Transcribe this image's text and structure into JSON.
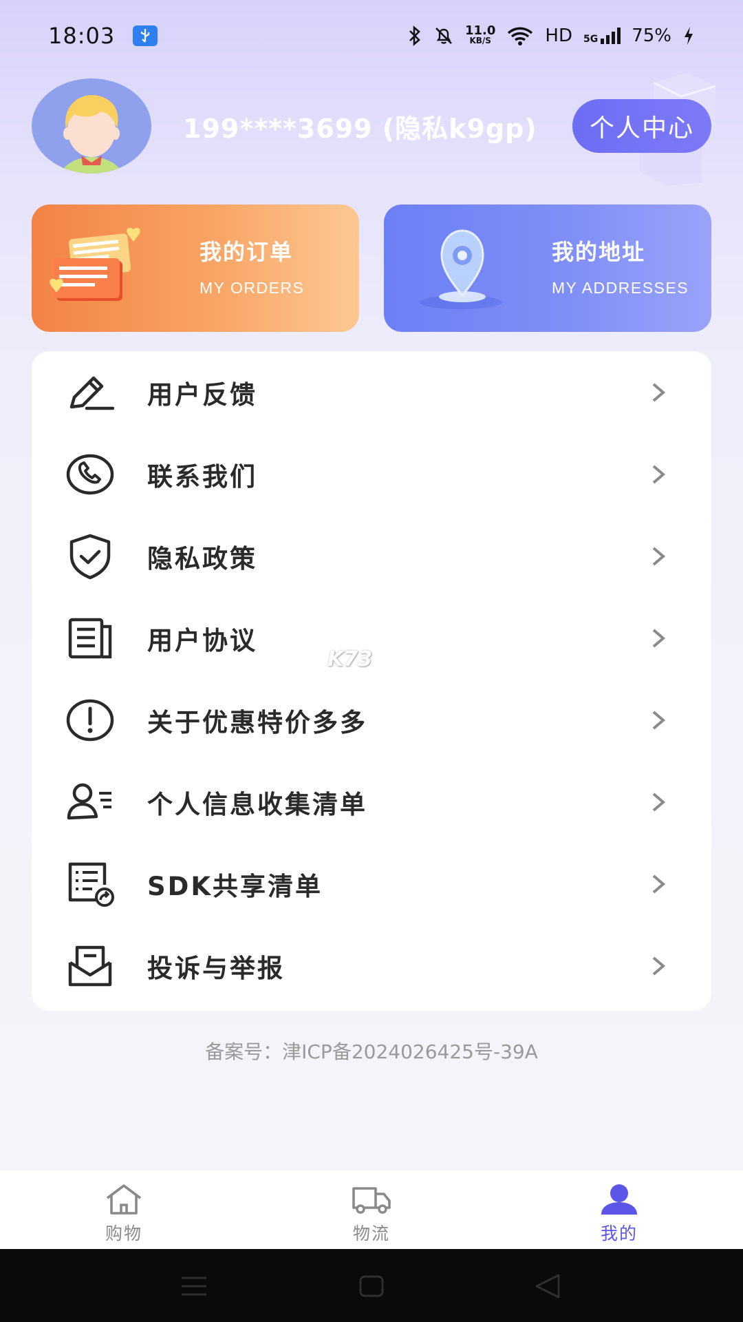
{
  "status": {
    "time": "18:03",
    "net_speed_value": "11.0",
    "net_speed_unit": "KB/S",
    "hd": "HD",
    "network": "5G",
    "battery": "75%"
  },
  "profile": {
    "name": "199****3699 (隐私k9gp)",
    "center_button": "个人中心"
  },
  "cards": [
    {
      "title": "我的订单",
      "subtitle": "MY ORDERS"
    },
    {
      "title": "我的地址",
      "subtitle": "MY ADDRESSES"
    }
  ],
  "menu": [
    {
      "label": "用户反馈",
      "icon": "edit-icon"
    },
    {
      "label": "联系我们",
      "icon": "phone-icon"
    },
    {
      "label": "隐私政策",
      "icon": "shield-check-icon"
    },
    {
      "label": "用户协议",
      "icon": "document-icon"
    },
    {
      "label": "关于优惠特价多多",
      "icon": "info-circle-icon"
    },
    {
      "label": "个人信息收集清单",
      "icon": "user-list-icon"
    },
    {
      "label": "SDK共享清单",
      "icon": "share-list-icon"
    },
    {
      "label": "投诉与举报",
      "icon": "mail-icon"
    }
  ],
  "icp": "备案号：津ICP备2024026425号-39A",
  "watermark": "K73",
  "tabs": [
    {
      "label": "购物",
      "icon": "home-icon",
      "active": false
    },
    {
      "label": "物流",
      "icon": "truck-icon",
      "active": false
    },
    {
      "label": "我的",
      "icon": "user-icon",
      "active": true
    }
  ],
  "colors": {
    "accent": "#5b55e8",
    "orders_card": "#f38246",
    "address_card": "#6c80f5"
  }
}
